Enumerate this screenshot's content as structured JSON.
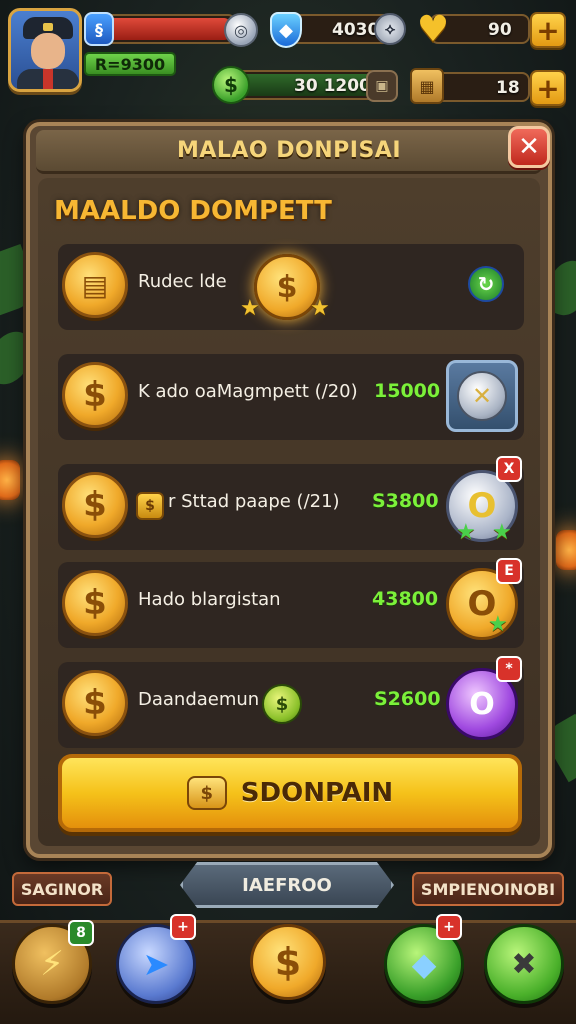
{
  "hud": {
    "level_badge": "R=9300",
    "resource1_value": "4030",
    "resource2_value": "90",
    "currency_value": "30 1200",
    "crates_value": "18",
    "plus_label": "+"
  },
  "panel": {
    "title": "MALAO DONPISAI",
    "close_label": "✕",
    "section_title": "MAALDO DOMPETT"
  },
  "rows": [
    {
      "label": "Rudec lde",
      "price": ""
    },
    {
      "label": "K ado oaMagmpett (/20)",
      "price": "15000"
    },
    {
      "label": "r Sttad paape (/21)",
      "price": "S3800"
    },
    {
      "label": "Hado blargistan",
      "price": "43800"
    },
    {
      "label": "Daandaemun",
      "price": "S2600"
    }
  ],
  "row_badges": [
    "X",
    "E",
    "*"
  ],
  "cta": {
    "label": "SDONPAIN"
  },
  "bottom": {
    "left_tag": "SAGINOR",
    "mid_tag": "IAEFROO",
    "right_tag": "SMPIENOINOBI"
  },
  "nav_badges": [
    "8",
    "+",
    "+"
  ],
  "icons": {
    "coin": "dollar-coin-icon",
    "gem": "blue-gem-icon",
    "crate": "crate-icon"
  },
  "colors": {
    "accent_gold": "#f7b733",
    "price_green": "#7cf03a",
    "panel_brown": "#5a4733",
    "close_red": "#d8322a"
  }
}
